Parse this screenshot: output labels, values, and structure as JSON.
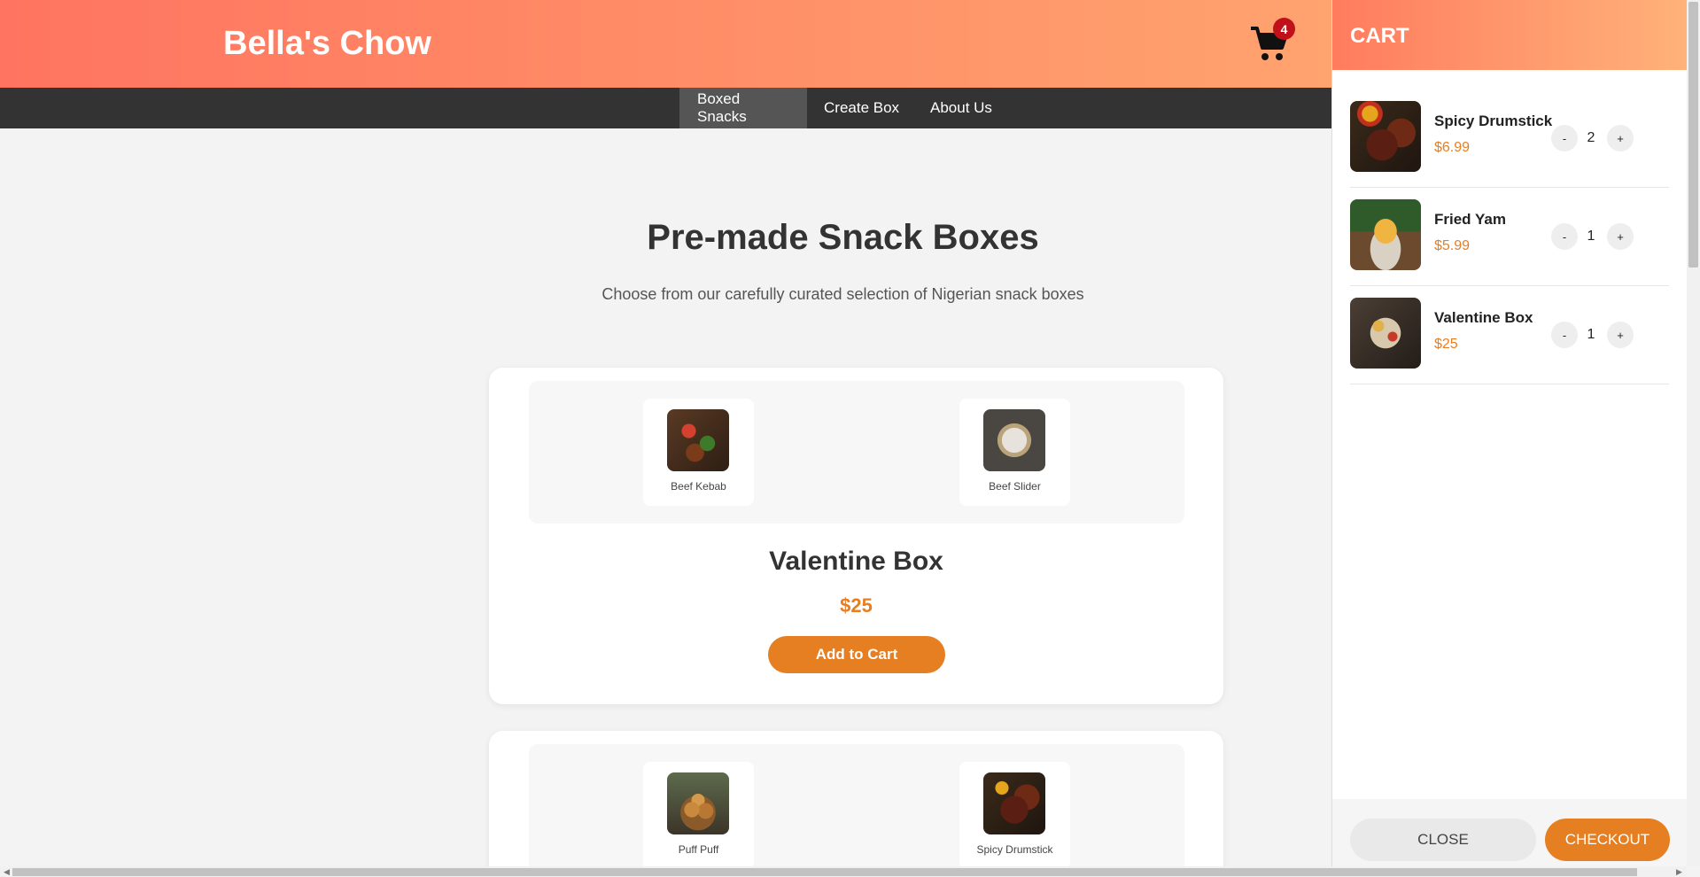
{
  "header": {
    "brand": "Bella's Chow",
    "cart_count": "4"
  },
  "nav": {
    "items": [
      {
        "label": "Boxed Snacks"
      },
      {
        "label": "Create Box"
      },
      {
        "label": "About Us"
      }
    ]
  },
  "main": {
    "title": "Pre-made Snack Boxes",
    "subtitle": "Choose from our carefully curated selection of Nigerian snack boxes",
    "boxes": [
      {
        "name": "Valentine Box",
        "price": "$25",
        "button": "Add to Cart",
        "items": [
          {
            "name": "Beef Kebab"
          },
          {
            "name": "Beef Slider"
          }
        ]
      },
      {
        "items": [
          {
            "name": "Puff Puff"
          },
          {
            "name": "Spicy Drumstick"
          }
        ]
      }
    ]
  },
  "cart": {
    "title": "CART",
    "items": [
      {
        "name": "Spicy Drumstick",
        "price": "$6.99",
        "qty": "2"
      },
      {
        "name": "Fried Yam",
        "price": "$5.99",
        "qty": "1"
      },
      {
        "name": "Valentine Box",
        "price": "$25",
        "qty": "1"
      }
    ],
    "minus": "-",
    "plus": "+",
    "close_label": "CLOSE",
    "checkout_label": "CHECKOUT"
  },
  "colors": {
    "accent": "#e67e22",
    "header_start": "#ff7460",
    "header_end": "#ffa36f",
    "nav_bg": "#333333",
    "badge": "#c0101a"
  },
  "icons": {
    "cart": "shopping-cart-icon"
  }
}
